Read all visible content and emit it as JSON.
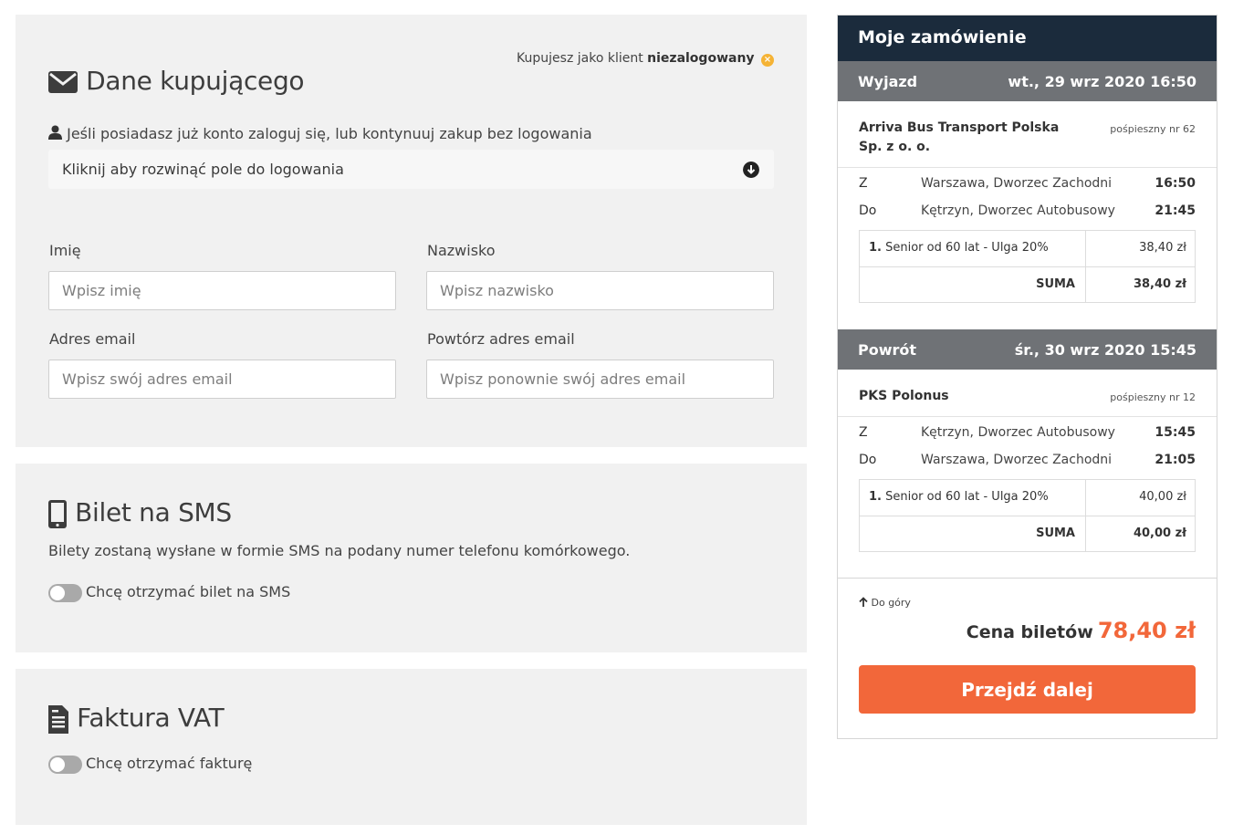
{
  "buyer": {
    "title": "Dane kupującego",
    "guest_prefix": "Kupujesz jako klient",
    "guest_status": "niezalogowany",
    "guest_close": "×",
    "account_note": "Jeśli posiadasz już konto zaloguj się, lub kontynuuj zakup bez logowania",
    "login_expander": "Kliknij aby rozwinąć pole do logowania",
    "first_name": {
      "label": "Imię",
      "placeholder": "Wpisz imię",
      "value": ""
    },
    "last_name": {
      "label": "Nazwisko",
      "placeholder": "Wpisz nazwisko",
      "value": ""
    },
    "email": {
      "label": "Adres email",
      "placeholder": "Wpisz swój adres email",
      "value": ""
    },
    "email_repeat": {
      "label": "Powtórz adres email",
      "placeholder": "Wpisz ponownie swój adres email",
      "value": ""
    }
  },
  "sms": {
    "title": "Bilet na SMS",
    "description": "Bilety zostaną wysłane w formie SMS na podany numer telefonu komórkowego.",
    "toggle_label": "Chcę otrzymać bilet na SMS",
    "toggle_on": false
  },
  "vat": {
    "title": "Faktura VAT",
    "toggle_label": "Chcę otrzymać fakturę",
    "toggle_on": false
  },
  "order": {
    "title": "Moje zamówienie",
    "outbound": {
      "label": "Wyjazd",
      "date": "wt., 29 wrz 2020 16:50",
      "carrier_line1": "Arriva Bus Transport Polska",
      "carrier_line2": "Sp. z o. o.",
      "route_no": "pośpieszny nr 62",
      "from_label": "Z",
      "from_stop": "Warszawa, Dworzec Zachodni",
      "from_time": "16:50",
      "to_label": "Do",
      "to_stop": "Kętrzyn, Dworzec Autobusowy",
      "to_time": "21:45",
      "ticket_no": "1.",
      "ticket_desc": "Senior od 60 lat - Ulga 20%",
      "ticket_price": "38,40 zł",
      "sum_label": "SUMA",
      "sum_value": "38,40 zł"
    },
    "return": {
      "label": "Powrót",
      "date": "śr., 30 wrz 2020 15:45",
      "carrier_line1": "PKS Polonus",
      "route_no": "pośpieszny nr 12",
      "from_label": "Z",
      "from_stop": "Kętrzyn, Dworzec Autobusowy",
      "from_time": "15:45",
      "to_label": "Do",
      "to_stop": "Warszawa, Dworzec Zachodni",
      "to_time": "21:05",
      "ticket_no": "1.",
      "ticket_desc": "Senior od 60 lat - Ulga 20%",
      "ticket_price": "40,00 zł",
      "sum_label": "SUMA",
      "sum_value": "40,00 zł"
    },
    "to_top": "Do góry",
    "total_label": "Cena biletów",
    "total_value": "78,40 zł",
    "continue_button": "Przejdź dalej"
  },
  "colors": {
    "accent": "#f2673a",
    "header": "#1b2b3c",
    "leg_bar": "#6f7276",
    "panel": "#f1f1f1"
  }
}
